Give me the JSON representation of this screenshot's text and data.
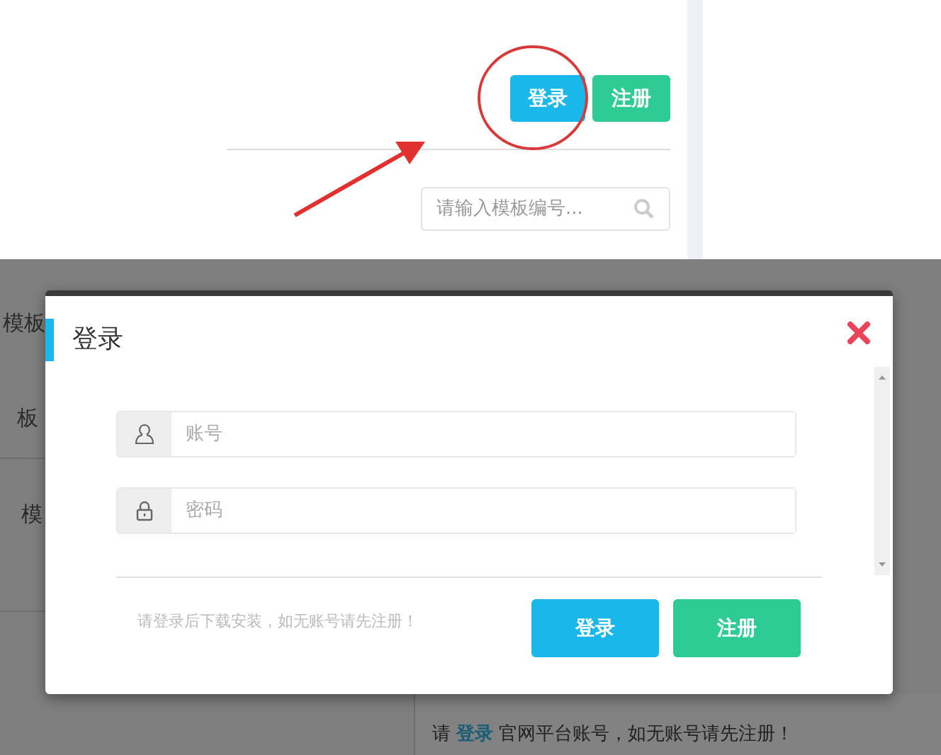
{
  "page": {
    "header_buttons": [
      {
        "label": "登录",
        "kind": "login"
      },
      {
        "label": "注册",
        "kind": "register"
      }
    ],
    "search": {
      "placeholder": "请输入模板编号..."
    },
    "sidebar_items": [
      "模板",
      "板",
      "模"
    ],
    "notice": {
      "before": "请",
      "link": "登录",
      "after": "官网平台账号，如无账号请先注册！"
    }
  },
  "dialog": {
    "title": "登录",
    "fields": [
      {
        "kind": "account",
        "placeholder": "账号"
      },
      {
        "kind": "password",
        "placeholder": "密码"
      }
    ],
    "hint": "请登录后下载安装，如无账号请先注册！",
    "buttons": [
      {
        "label": "登录",
        "kind": "login"
      },
      {
        "label": "注册",
        "kind": "register"
      }
    ]
  }
}
